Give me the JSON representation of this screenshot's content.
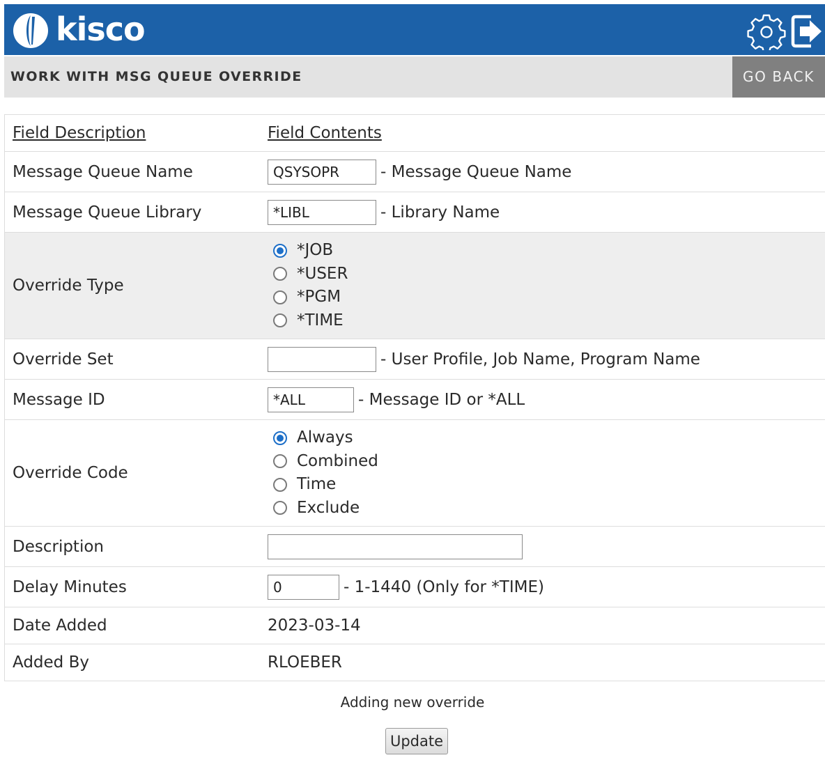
{
  "header": {
    "brand": "kisco",
    "settings_icon": "gear-icon",
    "exit_icon": "exit-icon"
  },
  "titlebar": {
    "title": "WORK WITH MSG QUEUE OVERRIDE",
    "go_back": "GO BACK"
  },
  "table": {
    "col1": "Field Description",
    "col2": "Field Contents"
  },
  "fields": {
    "msgq_name": {
      "label": "Message Queue Name",
      "value": "QSYSOPR",
      "hint": "- Message Queue Name"
    },
    "msgq_lib": {
      "label": "Message Queue Library",
      "value": "*LIBL",
      "hint": "- Library Name"
    },
    "override_type": {
      "label": "Override Type",
      "options": [
        "*JOB",
        "*USER",
        "*PGM",
        "*TIME"
      ],
      "selected": "*JOB"
    },
    "override_set": {
      "label": "Override Set",
      "value": "",
      "hint": "- User Profile, Job Name, Program Name"
    },
    "message_id": {
      "label": "Message ID",
      "value": "*ALL",
      "hint": "- Message ID or *ALL"
    },
    "override_code": {
      "label": "Override Code",
      "options": [
        "Always",
        "Combined",
        "Time",
        "Exclude"
      ],
      "selected": "Always"
    },
    "description": {
      "label": "Description",
      "value": ""
    },
    "delay_minutes": {
      "label": "Delay Minutes",
      "value": "0",
      "hint": "- 1-1440 (Only for *TIME)"
    },
    "date_added": {
      "label": "Date Added",
      "value": "2023-03-14"
    },
    "added_by": {
      "label": "Added By",
      "value": "RLOEBER"
    }
  },
  "footer": {
    "status": "Adding new override",
    "update": "Update"
  },
  "colors": {
    "brand_blue": "#1c61a8",
    "go_back_bg": "#808080",
    "radio_selected": "#1d6fc8"
  }
}
